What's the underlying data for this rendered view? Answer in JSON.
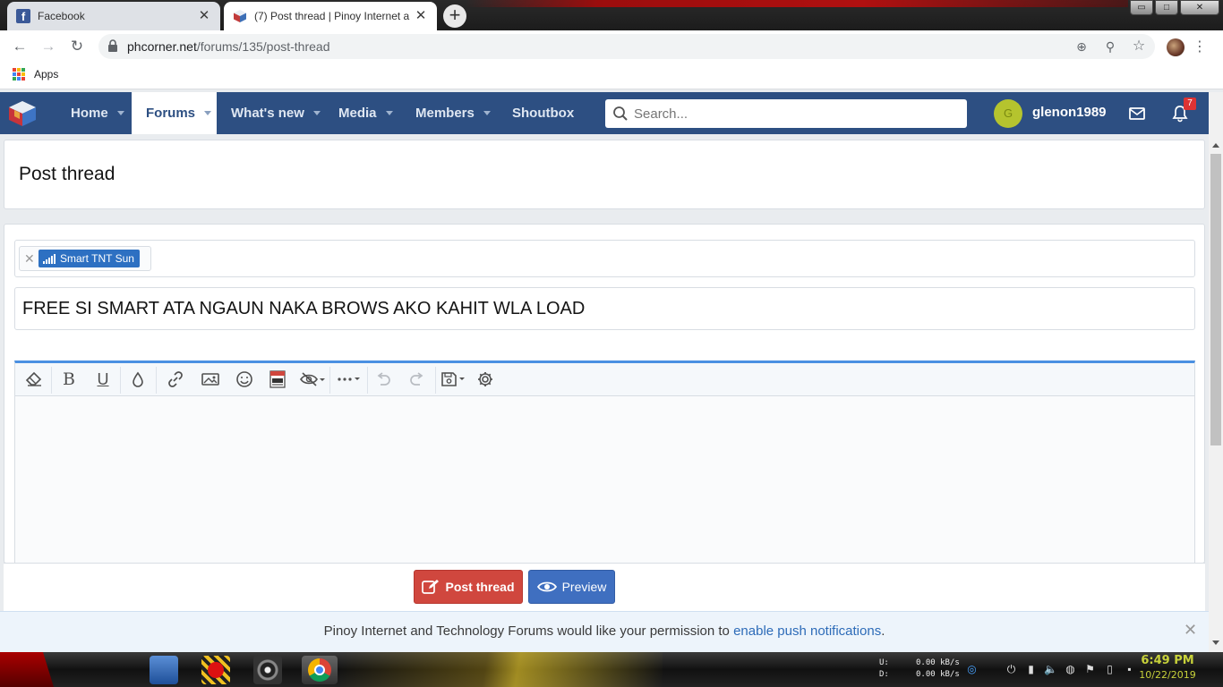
{
  "browser": {
    "tabs": [
      {
        "title": "Facebook",
        "active": false
      },
      {
        "title": "(7) Post thread | Pinoy Internet a",
        "active": true
      }
    ],
    "url_host": "phcorner.net",
    "url_path": "/forums/135/post-thread",
    "bookmarks": {
      "apps_label": "Apps"
    }
  },
  "site": {
    "nav": [
      {
        "label": "Home"
      },
      {
        "label": "Forums"
      },
      {
        "label": "What's new"
      },
      {
        "label": "Media"
      },
      {
        "label": "Members"
      },
      {
        "label": "Shoutbox"
      }
    ],
    "search_placeholder": "Search...",
    "user": {
      "initial": "G",
      "name": "glenon1989"
    },
    "alerts_count": "7",
    "accent_color": "#2d4f82"
  },
  "page": {
    "title": "Post thread",
    "prefix_label": "Smart TNT Sun",
    "thread_title": "FREE SI SMART ATA NGAUN NAKA BROWS AKO KAHIT WLA LOAD",
    "editor_icons": [
      "eraser-icon",
      "bold-icon",
      "underline-icon",
      "color-drop-icon",
      "link-icon",
      "image-icon",
      "smiley-icon",
      "media-icon",
      "hide-icon",
      "more-icon",
      "undo-icon",
      "redo-icon",
      "drafts-icon",
      "settings-icon"
    ],
    "buttons": {
      "post_thread": "Post thread",
      "preview": "Preview"
    },
    "push_notice": {
      "text": "Pinoy Internet and Technology Forums would like your permission to ",
      "link": "enable push notifications",
      "end": "."
    }
  },
  "taskbar": {
    "net_labels": {
      "up": "U:",
      "down": "D:"
    },
    "net_values": {
      "up": "0.00 kB/s",
      "down": "0.00 kB/s"
    },
    "time": "6:49 PM",
    "date": "10/22/2019"
  }
}
